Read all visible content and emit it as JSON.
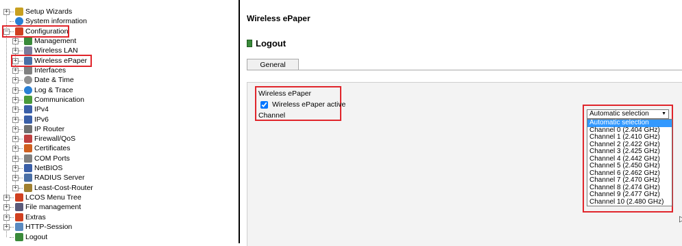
{
  "tree": {
    "items": [
      {
        "label": "Setup Wizards",
        "icon": "wand-icon",
        "color": "#c8a020",
        "expander": "+"
      },
      {
        "label": "System information",
        "icon": "info-icon",
        "color": "#2a7fd4",
        "expander": ""
      },
      {
        "label": "Configuration",
        "icon": "config-icon",
        "color": "#d04020",
        "expander": "−"
      },
      {
        "label": "Management",
        "icon": "management-icon",
        "color": "#3a8a3a",
        "expander": "+"
      },
      {
        "label": "Wireless LAN",
        "icon": "wlan-icon",
        "color": "#7a7a9a",
        "expander": "+"
      },
      {
        "label": "Wireless ePaper",
        "icon": "epaper-icon",
        "color": "#4a6fa5",
        "expander": "+"
      },
      {
        "label": "Interfaces",
        "icon": "interfaces-icon",
        "color": "#808080",
        "expander": "+"
      },
      {
        "label": "Date & Time",
        "icon": "clock-icon",
        "color": "#909090",
        "expander": "+"
      },
      {
        "label": "Log & Trace",
        "icon": "info-icon",
        "color": "#2a7fd4",
        "expander": "+"
      },
      {
        "label": "Communication",
        "icon": "communication-icon",
        "color": "#4a9a3a",
        "expander": "+"
      },
      {
        "label": "IPv4",
        "icon": "network-icon",
        "color": "#3a5fa8",
        "expander": "+"
      },
      {
        "label": "IPv6",
        "icon": "network-icon",
        "color": "#3a5fa8",
        "expander": "+"
      },
      {
        "label": "IP Router",
        "icon": "router-icon",
        "color": "#707070",
        "expander": "+"
      },
      {
        "label": "Firewall/QoS",
        "icon": "firewall-icon",
        "color": "#c04040",
        "expander": "+"
      },
      {
        "label": "Certificates",
        "icon": "certificate-icon",
        "color": "#d06020",
        "expander": "+"
      },
      {
        "label": "COM Ports",
        "icon": "port-icon",
        "color": "#808080",
        "expander": "+"
      },
      {
        "label": "NetBIOS",
        "icon": "network-icon",
        "color": "#3a5fa8",
        "expander": "+"
      },
      {
        "label": "RADIUS Server",
        "icon": "server-icon",
        "color": "#4a6fa5",
        "expander": "+"
      },
      {
        "label": "Least-Cost-Router",
        "icon": "router-icon",
        "color": "#a08030",
        "expander": "+"
      },
      {
        "label": "LCOS Menu Tree",
        "icon": "config-icon",
        "color": "#d04020",
        "expander": "+"
      },
      {
        "label": "File management",
        "icon": "file-icon",
        "color": "#5a5a7a",
        "expander": "+"
      },
      {
        "label": "Extras",
        "icon": "extras-icon",
        "color": "#d04020",
        "expander": "+"
      },
      {
        "label": "HTTP-Session",
        "icon": "session-icon",
        "color": "#5a8ac0",
        "expander": "+"
      },
      {
        "label": "Logout",
        "icon": "logout-icon",
        "color": "#3a8a3a",
        "expander": ""
      }
    ]
  },
  "content": {
    "title": "Wireless ePaper",
    "logout_label": "Logout",
    "tab_general": "General",
    "group_label": "Wireless ePaper",
    "active_label": "Wireless ePaper active",
    "active_checked": true,
    "channel_label": "Channel",
    "channel_selected": "Automatic selection",
    "channel_options": [
      "Automatic selection",
      "Channel 0 (2.404 GHz)",
      "Channel 1 (2.410 GHz)",
      "Channel 2 (2.422 GHz)",
      "Channel 3 (2.425 GHz)",
      "Channel 4 (2.442 GHz)",
      "Channel 5 (2.450 GHz)",
      "Channel 6 (2.462 GHz)",
      "Channel 7 (2.470 GHz)",
      "Channel 8 (2.474 GHz)",
      "Channel 9 (2.477 GHz)",
      "Channel 10 (2.480 GHz)"
    ]
  },
  "colors": {
    "highlight": "#e0242a",
    "selection": "#3399ff"
  }
}
